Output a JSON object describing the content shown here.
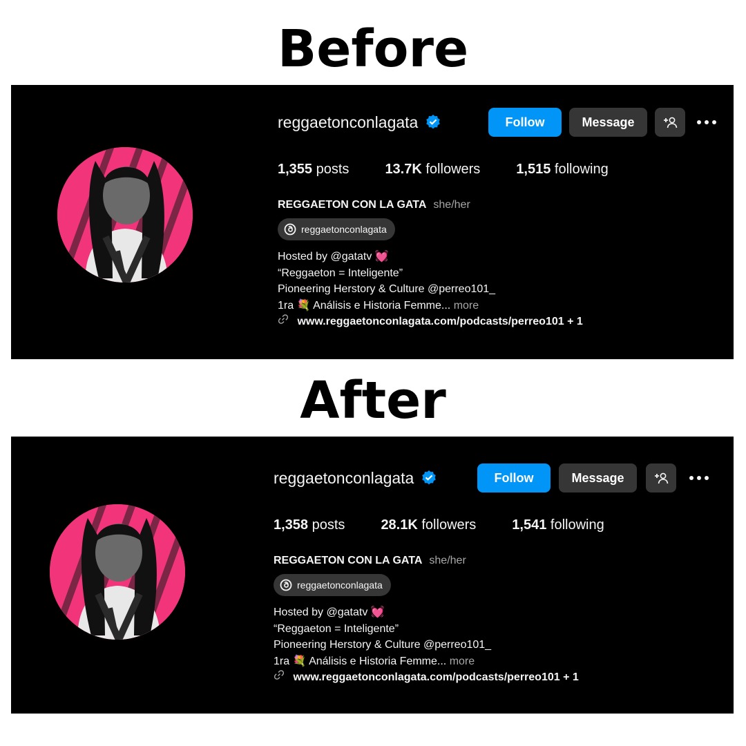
{
  "before": {
    "heading": "Before",
    "username": "reggaetonconlagata",
    "follow_label": "Follow",
    "message_label": "Message",
    "add_person_label": "+",
    "stats": {
      "posts_count": "1,355",
      "posts_label": "posts",
      "followers_count": "13.7K",
      "followers_label": "followers",
      "following_count": "1,515",
      "following_label": "following"
    },
    "full_name": "REGGAETON CON LA GATA",
    "pronouns": "she/her",
    "threads_handle": "reggaetonconlagata",
    "bio": {
      "line1": "Hosted by @gatatv",
      "line1_emoji": "💓",
      "line2": "“Reggaeton = Inteligente”",
      "line3": "Pioneering Herstory & Culture @perreo101_",
      "line4_prefix": "1ra",
      "line4_emoji": "💐",
      "line4_text": "Análisis e Historia Femme...",
      "more_label": "more"
    },
    "link": "www.reggaetonconlagata.com/podcasts/perreo101 + 1"
  },
  "after": {
    "heading": "After",
    "username": "reggaetonconlagata",
    "follow_label": "Follow",
    "message_label": "Message",
    "add_person_label": "+",
    "stats": {
      "posts_count": "1,358",
      "posts_label": "posts",
      "followers_count": "28.1K",
      "followers_label": "followers",
      "following_count": "1,541",
      "following_label": "following"
    },
    "full_name": "REGGAETON CON LA GATA",
    "pronouns": "she/her",
    "threads_handle": "reggaetonconlagata",
    "bio": {
      "line1": "Hosted by @gatatv",
      "line1_emoji": "💓",
      "line2": "“Reggaeton = Inteligente”",
      "line3": "Pioneering Herstory & Culture @perreo101_",
      "line4_prefix": "1ra",
      "line4_emoji": "💐",
      "line4_text": "Análisis e Historia Femme...",
      "more_label": "more"
    },
    "link": "www.reggaetonconlagata.com/podcasts/perreo101 + 1"
  },
  "colors": {
    "follow_blue": "#0095f6",
    "button_gray": "#363636",
    "verified_blue": "#0095f6",
    "avatar_pink": "#f2357a",
    "panel_bg": "#000000"
  },
  "icons": [
    "verified-badge-icon",
    "add-person-icon",
    "more-options-icon",
    "threads-icon",
    "link-icon",
    "heart-emoji",
    "bouquet-emoji"
  ]
}
